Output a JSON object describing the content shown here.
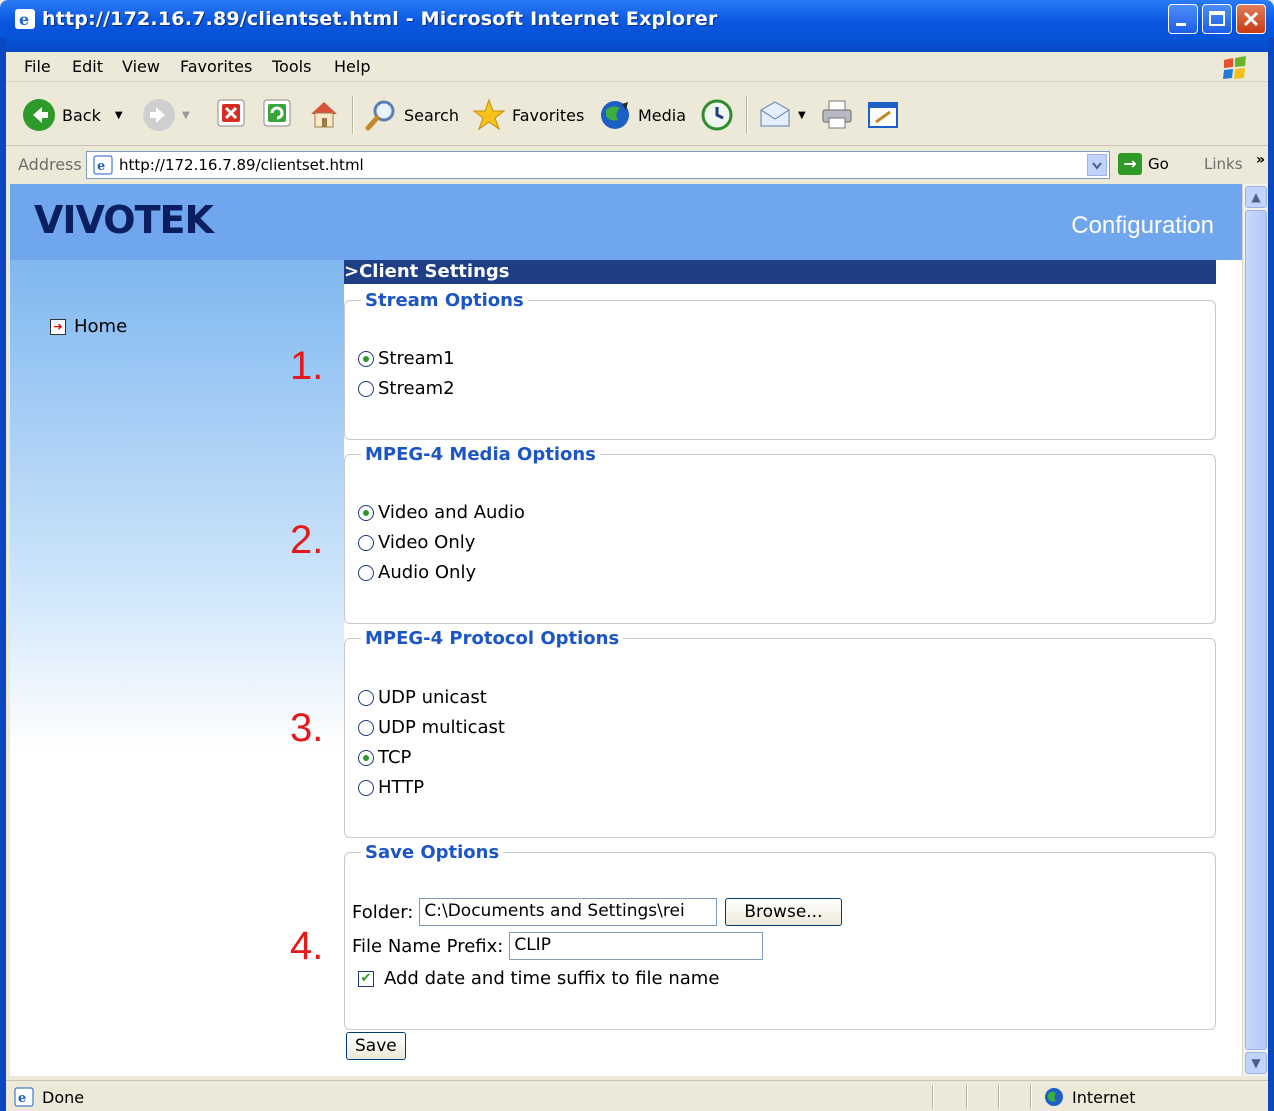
{
  "window": {
    "title": "http://172.16.7.89/clientset.html - Microsoft Internet Explorer"
  },
  "menu": [
    "File",
    "Edit",
    "View",
    "Favorites",
    "Tools",
    "Help"
  ],
  "toolbar": {
    "back": "Back",
    "search": "Search",
    "favorites": "Favorites",
    "media": "Media"
  },
  "address": {
    "label": "Address",
    "url": "http://172.16.7.89/clientset.html",
    "go": "Go",
    "links": "Links"
  },
  "page": {
    "brand": "VIVOTEK",
    "header_title": "Configuration",
    "nav": {
      "home": "Home"
    },
    "section_title": ">Client Settings"
  },
  "stream_options": {
    "legend": "Stream Options",
    "marker": "1.",
    "options": [
      {
        "label": "Stream1",
        "selected": true
      },
      {
        "label": "Stream2",
        "selected": false
      }
    ]
  },
  "media_options": {
    "legend": "MPEG-4 Media Options",
    "marker": "2.",
    "options": [
      {
        "label": "Video and Audio",
        "selected": true
      },
      {
        "label": "Video Only",
        "selected": false
      },
      {
        "label": "Audio Only",
        "selected": false
      }
    ]
  },
  "protocol_options": {
    "legend": "MPEG-4 Protocol Options",
    "marker": "3.",
    "options": [
      {
        "label": "UDP unicast",
        "selected": false
      },
      {
        "label": "UDP multicast",
        "selected": false
      },
      {
        "label": "TCP",
        "selected": true
      },
      {
        "label": "HTTP",
        "selected": false
      }
    ]
  },
  "save_options": {
    "legend": "Save Options",
    "marker": "4.",
    "folder_label": "Folder:",
    "folder_value": "C:\\Documents and Settings\\rei",
    "browse": "Browse...",
    "prefix_label": "File Name Prefix:",
    "prefix_value": "CLIP",
    "suffix_label": "Add date and time suffix to file name",
    "suffix_checked": true
  },
  "save_button": "Save",
  "status": {
    "left": "Done",
    "zone": "Internet"
  }
}
